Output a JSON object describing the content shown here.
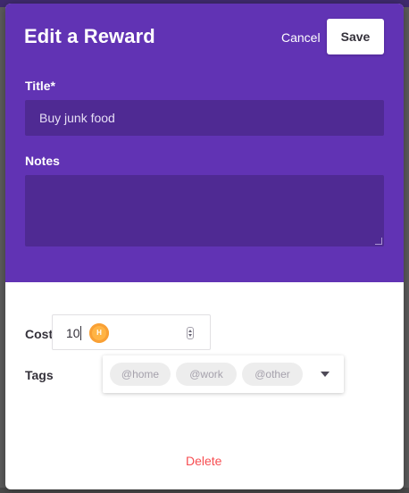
{
  "modal": {
    "title": "Edit a Reward",
    "cancel_label": "Cancel",
    "save_label": "Save",
    "title_label": "Title*",
    "title_value": "Buy junk food",
    "notes_label": "Notes",
    "notes_value": "",
    "cost_label": "Cost",
    "cost_value": "10",
    "coin_letter": "H",
    "tags_label": "Tags",
    "tags": [
      "@home",
      "@work",
      "@other"
    ],
    "delete_label": "Delete"
  },
  "colors": {
    "header_bg": "#6133b4",
    "input_bg": "#4f2a93",
    "delete": "#f74e52",
    "coin": "#ffb445"
  },
  "icons": [
    "coin-icon",
    "spinner-icon",
    "dropdown-caret-icon",
    "resize-handle-icon"
  ]
}
